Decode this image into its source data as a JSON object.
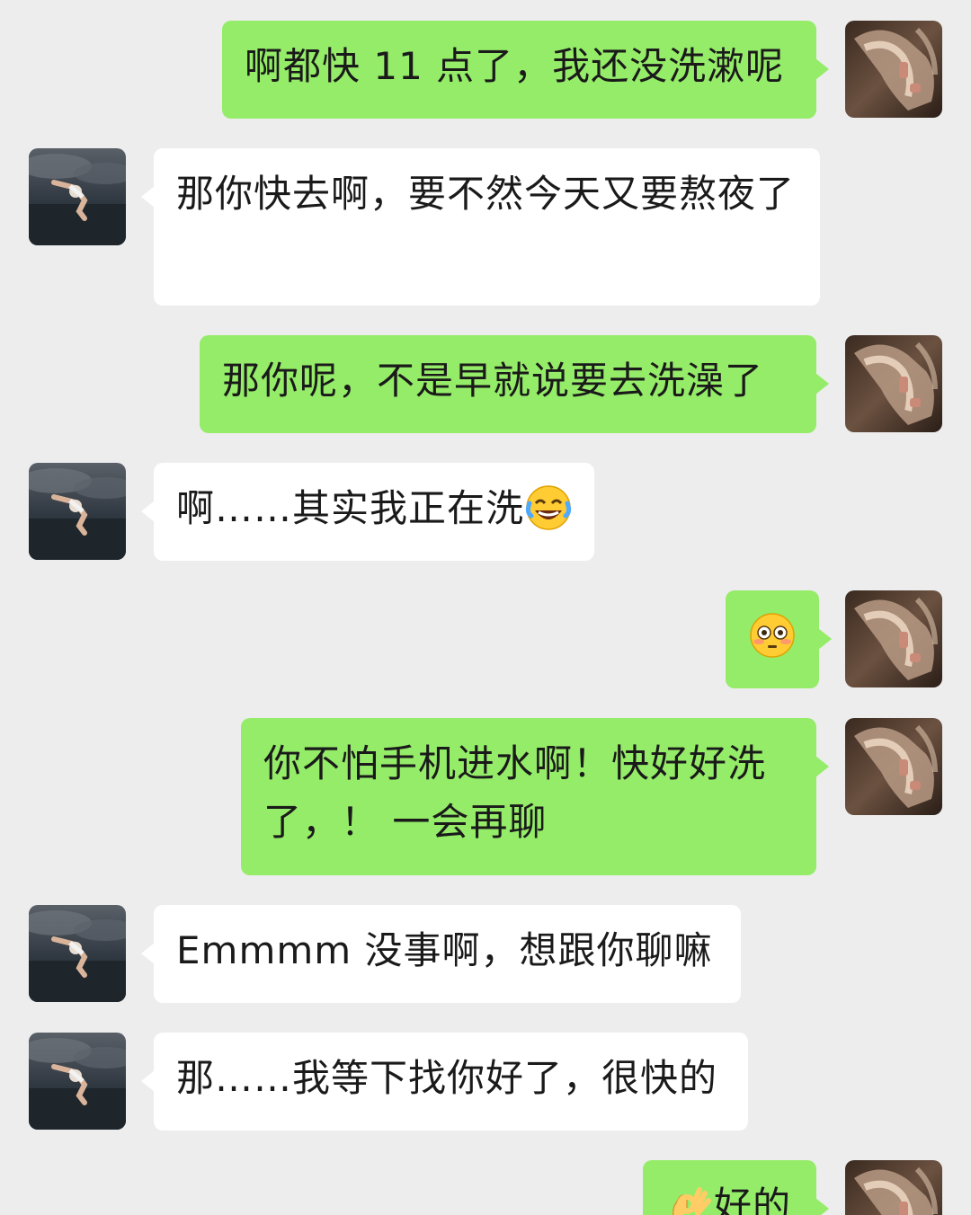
{
  "messages": [
    {
      "from": "me",
      "text": "啊都快 11 点了，我还没洗漱呢"
    },
    {
      "from": "them",
      "text": "那你快去啊，要不然今天又要熬夜了"
    },
    {
      "from": "me",
      "text": "那你呢，不是早就说要去洗澡了"
    },
    {
      "from": "them",
      "text": "啊……其实我正在洗",
      "emoji": "tears-of-joy-emoji"
    },
    {
      "from": "me",
      "text": "",
      "emoji": "flushed-face-emoji"
    },
    {
      "from": "me",
      "text": "你不怕手机进水啊！快好好洗了，！ 一会再聊"
    },
    {
      "from": "them",
      "text": "Emmmm 没事啊，想跟你聊嘛"
    },
    {
      "from": "them",
      "text": "那……我等下找你好了，很快的"
    },
    {
      "from": "me",
      "text": "好的",
      "emoji": "ok-hand-emoji"
    }
  ],
  "colors": {
    "background": "#ededed",
    "me_bubble": "#95ec69",
    "them_bubble": "#ffffff",
    "text": "#1a1a1a"
  }
}
